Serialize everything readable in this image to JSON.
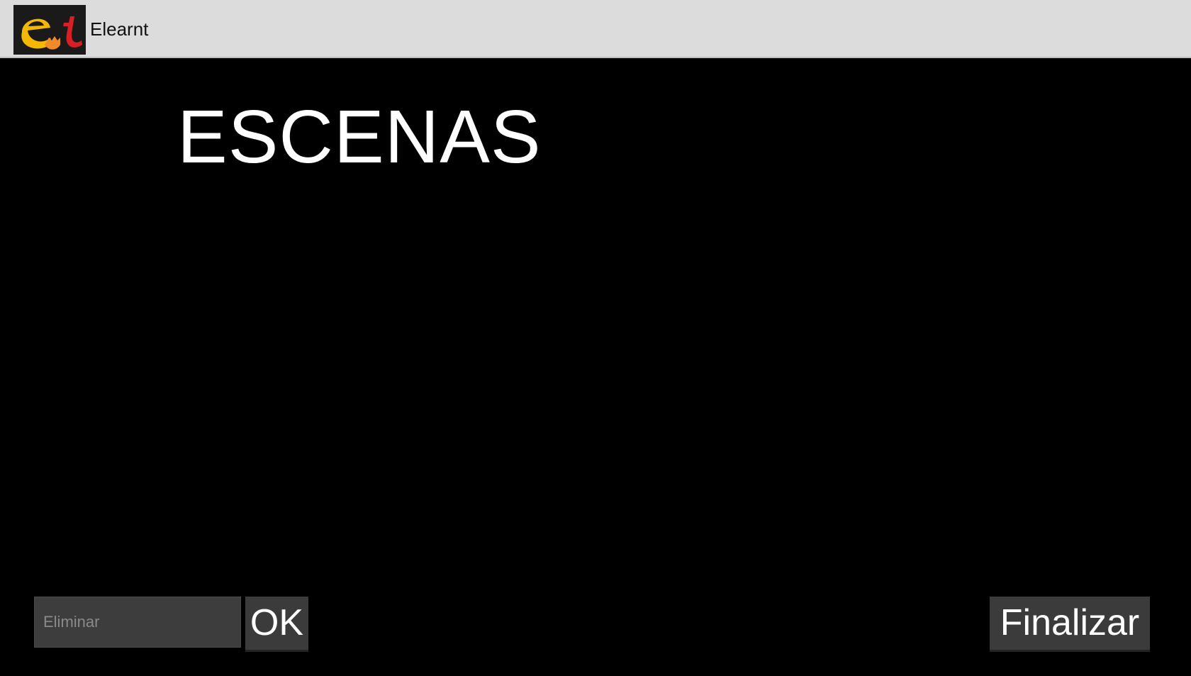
{
  "app": {
    "title": "Elearnt",
    "logo_icon": "elearnt-logo-icon",
    "logo_colors": {
      "e": "#f5b800",
      "t": "#d81f26",
      "hand": "#f08a2a",
      "background": "#1a1a1a"
    }
  },
  "main": {
    "heading": "ESCENAS"
  },
  "footer": {
    "delete_input": {
      "value": "",
      "placeholder": "Eliminar"
    },
    "ok_label": "OK",
    "finish_label": "Finalizar"
  },
  "colors": {
    "titlebar_bg": "#dcdcdc",
    "screen_bg": "#000000",
    "button_bg": "#3b3b3b",
    "input_bg": "#3d3d3d",
    "text_light": "#ffffff"
  }
}
